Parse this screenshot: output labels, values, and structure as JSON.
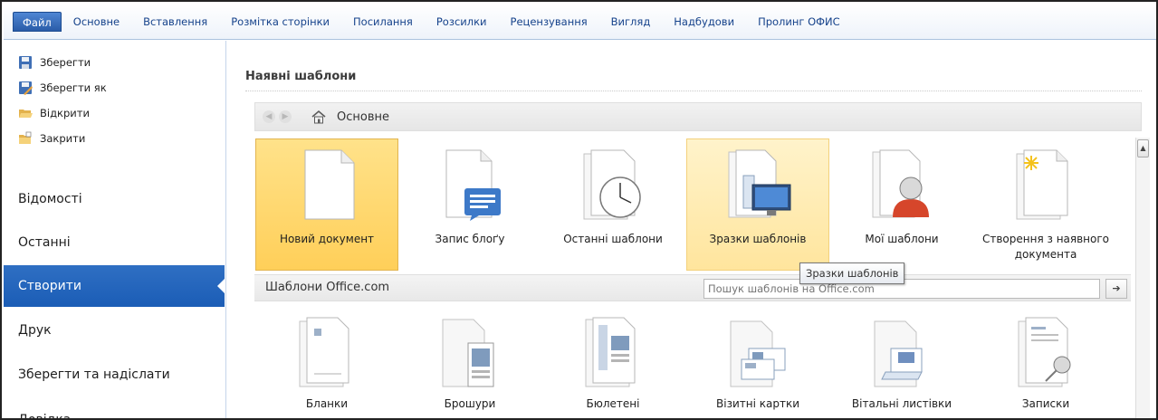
{
  "ribbon": {
    "tabs": [
      "Файл",
      "Основне",
      "Вставлення",
      "Розмітка сторінки",
      "Посилання",
      "Розсилки",
      "Рецензування",
      "Вигляд",
      "Надбудови",
      "Пролинг ОФИС"
    ]
  },
  "nav": {
    "commands": [
      {
        "label": "Зберегти",
        "icon": "save-icon"
      },
      {
        "label": "Зберегти як",
        "icon": "save-as-icon"
      },
      {
        "label": "Відкрити",
        "icon": "open-folder-icon"
      },
      {
        "label": "Закрити",
        "icon": "close-folder-icon"
      }
    ],
    "items": [
      "Відомості",
      "Останні",
      "Створити",
      "Друк",
      "Зберегти та надіслати",
      "Довідка"
    ],
    "active": "Створити"
  },
  "main": {
    "section_title": "Наявні шаблони",
    "breadcrumb": "Основне",
    "templates": [
      {
        "label": "Новий документ",
        "icon": "blank-document-icon",
        "state": "selected"
      },
      {
        "label": "Запис блоґу",
        "icon": "blog-post-icon",
        "state": "normal"
      },
      {
        "label": "Останні шаблони",
        "icon": "recent-templates-icon",
        "state": "normal"
      },
      {
        "label": "Зразки шаблонів",
        "icon": "sample-templates-icon",
        "state": "hover"
      },
      {
        "label": "Мої шаблони",
        "icon": "my-templates-icon",
        "state": "normal"
      },
      {
        "label": "Створення з наявного документа",
        "icon": "new-from-existing-icon",
        "state": "normal"
      }
    ],
    "tooltip": "Зразки шаблонів",
    "office": {
      "label": "Шаблони Office.com",
      "search_placeholder": "Пошук шаблонів на Office.com"
    },
    "office_templates": [
      {
        "label": "Бланки",
        "icon": "forms-icon"
      },
      {
        "label": "Брошури",
        "icon": "brochures-icon"
      },
      {
        "label": "Бюлетені",
        "icon": "newsletters-icon"
      },
      {
        "label": "Візитні картки",
        "icon": "business-cards-icon"
      },
      {
        "label": "Вітальні листівки",
        "icon": "greeting-cards-icon"
      },
      {
        "label": "Записки",
        "icon": "memos-icon"
      }
    ]
  },
  "colors": {
    "file_tab": "#2a5ca8",
    "nav_active": "#1b5db6",
    "tile_selected": "#ffcf59",
    "tile_hover": "#ffe59d"
  }
}
